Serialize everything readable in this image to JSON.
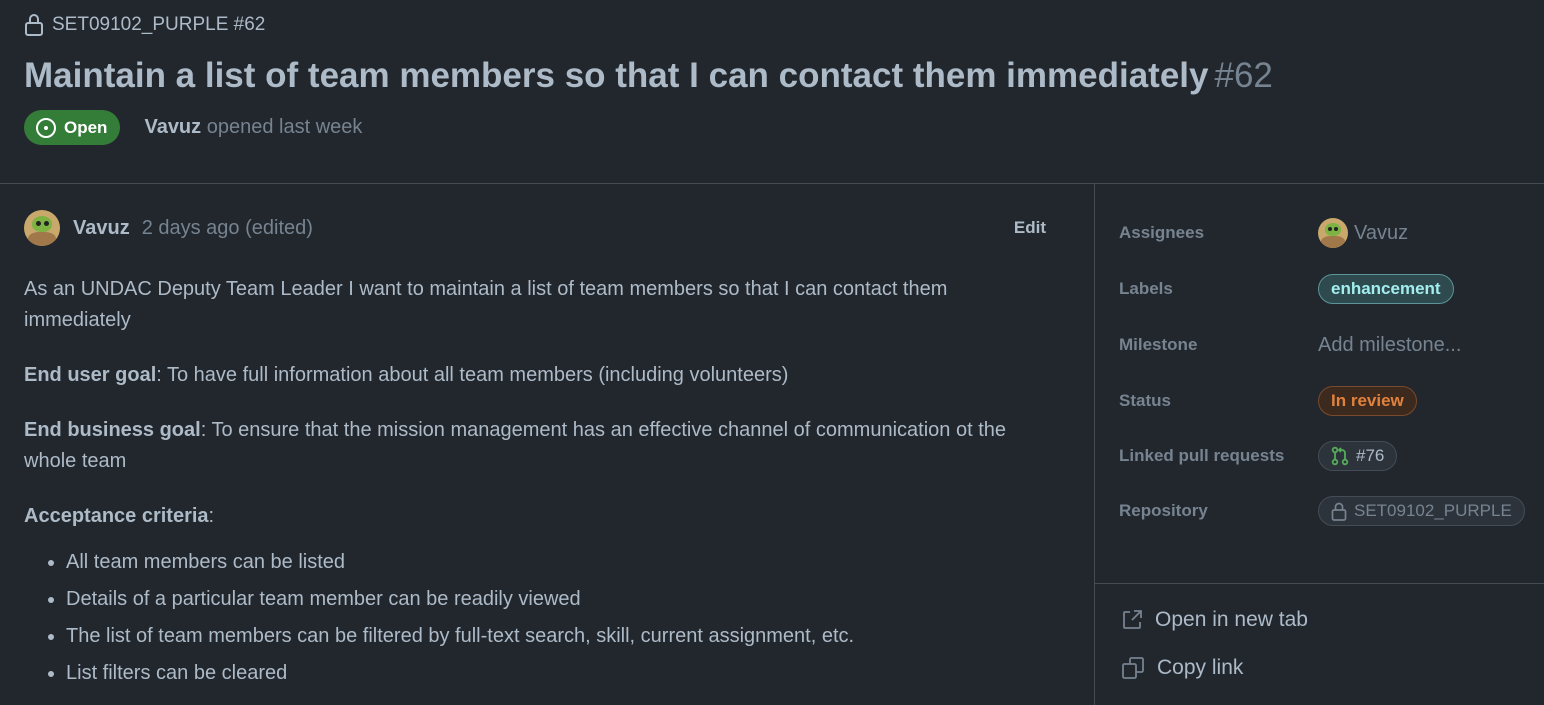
{
  "header": {
    "repo_label": "SET09102_PURPLE #62",
    "title": "Maintain a list of team members so that I can contact them immediately",
    "number": "#62",
    "state": "Open",
    "author": "Vavuz",
    "opened_text": "opened last week"
  },
  "comment": {
    "author": "Vavuz",
    "time": "2 days ago (edited)",
    "edit_label": "Edit",
    "intro": "As an UNDAC Deputy Team Leader I want to maintain a list of team members so that I can contact them immediately",
    "end_user_goal_label": "End user goal",
    "end_user_goal_text": ": To have full information about all team members (including volunteers)",
    "end_business_goal_label": "End business goal",
    "end_business_goal_text": ": To ensure that the mission management has an effective channel of communication ot the whole team",
    "acceptance_label": "Acceptance criteria",
    "acceptance_suffix": ":",
    "criteria": [
      "All team members can be listed",
      "Details of a particular team member can be readily viewed",
      "The list of team members can be filtered by full-text search, skill, current assignment, etc.",
      "List filters can be cleared"
    ]
  },
  "sidebar": {
    "assignees_label": "Assignees",
    "assignee": "Vavuz",
    "labels_label": "Labels",
    "label_value": "enhancement",
    "milestone_label": "Milestone",
    "milestone_value": "Add milestone...",
    "status_label": "Status",
    "status_value": "In review",
    "linked_pr_label": "Linked pull requests",
    "linked_pr_value": "#76",
    "repository_label": "Repository",
    "repository_value": "SET09102_PURPLE",
    "open_new_tab": "Open in new tab",
    "copy_link": "Copy link"
  },
  "colors": {
    "background": "#22272e",
    "open_green": "#347d39",
    "label_enhancement": "#a2eeef",
    "status_in_review": "#e0823d"
  }
}
